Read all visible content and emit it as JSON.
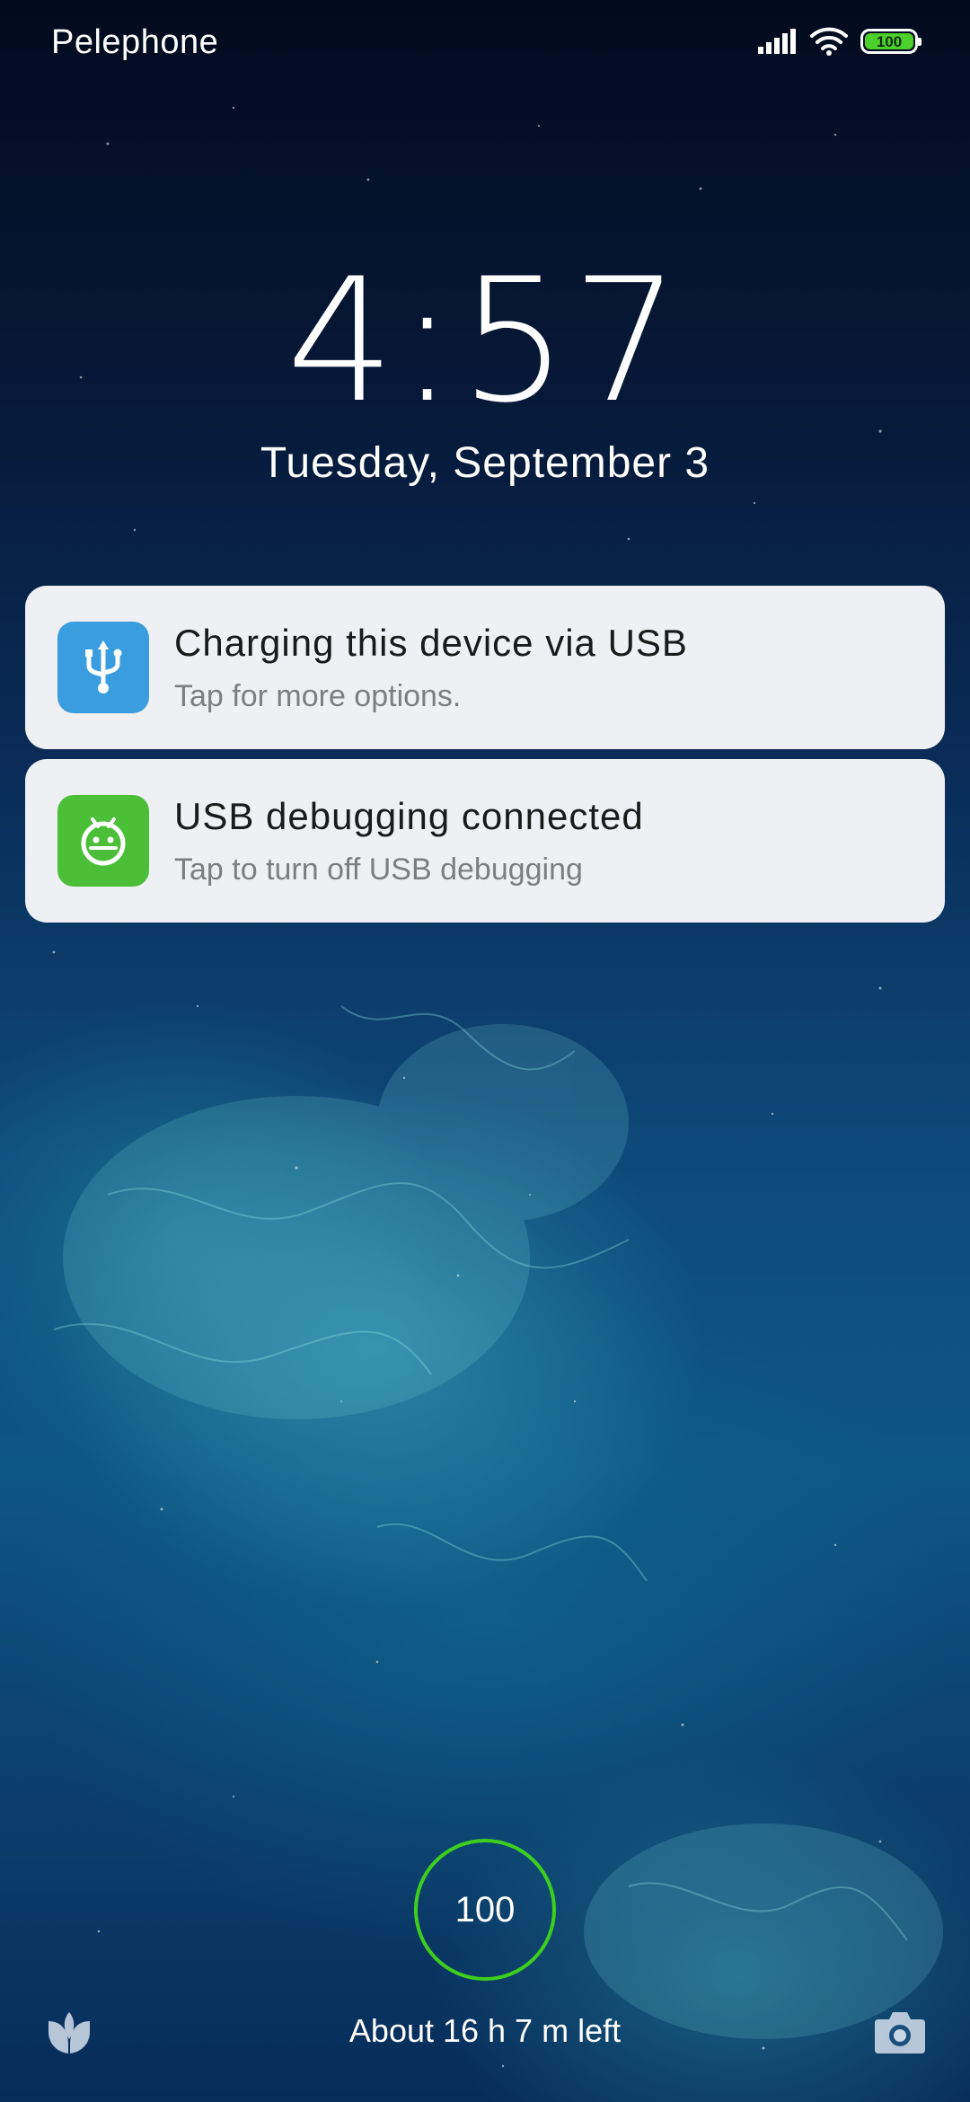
{
  "status_bar": {
    "carrier": "Pelephone",
    "battery_level": "100",
    "signal_icon": "signal-bars-icon",
    "wifi_icon": "wifi-icon"
  },
  "lock_screen": {
    "time": "4:57",
    "date": "Tuesday, September 3"
  },
  "notifications": [
    {
      "icon": "usb-icon",
      "icon_color": "#3a9de0",
      "title": "Charging this device via USB",
      "subtitle": "Tap for more options."
    },
    {
      "icon": "android-debug-icon",
      "icon_color": "#4bbf38",
      "title": "USB debugging connected",
      "subtitle": "Tap to turn off USB debugging"
    }
  ],
  "charging": {
    "percent": "100",
    "ring_color": "#3ecf1e",
    "time_left": "About 16 h 7 m left"
  },
  "bottom_shortcuts": {
    "left_icon": "leaf-icon",
    "right_icon": "camera-icon"
  }
}
